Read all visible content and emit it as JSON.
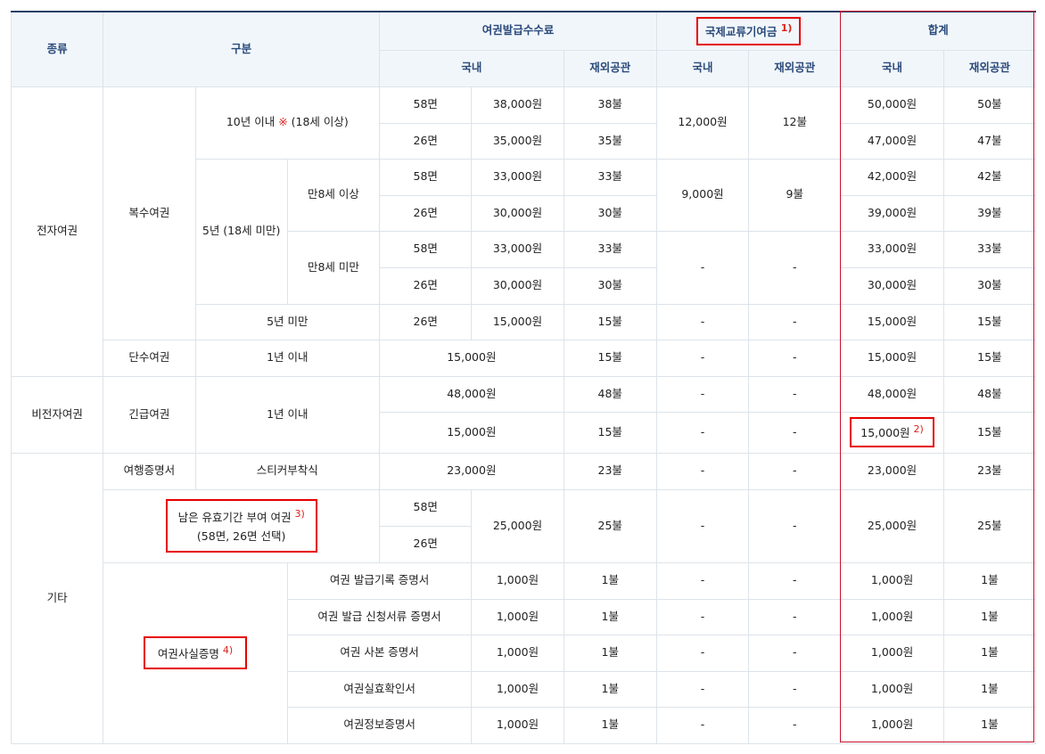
{
  "header": {
    "type": "종류",
    "category": "구분",
    "fee": "여권발급수수료",
    "contribution": "국제교류기여금",
    "contribution_note": "1)",
    "total": "합계",
    "domestic": "국내",
    "overseas": "재외공관"
  },
  "electronic": {
    "type": "전자여권",
    "multiple": "복수여권",
    "ten_year_prefix": "10년 이내 ",
    "ten_year_mark": "※",
    "ten_year_suffix": " (18세 이상)",
    "five_year": "5년 (18세 미만)",
    "age8_up": "만8세 이상",
    "age8_down": "만8세 미만",
    "under_five": "5년 미만",
    "single": "단수여권",
    "one_year": "1년 이내",
    "rows": [
      {
        "pages": "58면",
        "fee": "38,000원",
        "fee_ov": "38불",
        "total": "50,000원",
        "total_ov": "50불"
      },
      {
        "pages": "26면",
        "fee": "35,000원",
        "fee_ov": "35불",
        "total": "47,000원",
        "total_ov": "47불"
      },
      {
        "pages": "58면",
        "fee": "33,000원",
        "fee_ov": "33불",
        "total": "42,000원",
        "total_ov": "42불"
      },
      {
        "pages": "26면",
        "fee": "30,000원",
        "fee_ov": "30불",
        "total": "39,000원",
        "total_ov": "39불"
      },
      {
        "pages": "58면",
        "fee": "33,000원",
        "fee_ov": "33불",
        "total": "33,000원",
        "total_ov": "33불"
      },
      {
        "pages": "26면",
        "fee": "30,000원",
        "fee_ov": "30불",
        "total": "30,000원",
        "total_ov": "30불"
      },
      {
        "pages": "26면",
        "fee": "15,000원",
        "fee_ov": "15불",
        "total": "15,000원",
        "total_ov": "15불"
      }
    ],
    "contrib_10y": "12,000원",
    "contrib_10y_ov": "12불",
    "contrib_5y": "9,000원",
    "contrib_5y_ov": "9불",
    "single_fee": "15,000원",
    "single_fee_ov": "15불",
    "single_total": "15,000원",
    "single_total_ov": "15불"
  },
  "non_electronic": {
    "type": "비전자여권",
    "emergency": "긴급여권",
    "one_year": "1년 이내",
    "rows": [
      {
        "fee": "48,000원",
        "fee_ov": "48불",
        "total": "48,000원",
        "total_ov": "48불"
      },
      {
        "fee": "15,000원",
        "fee_ov": "15불",
        "total": "15,000원",
        "total_ov": "15불",
        "note": "2)"
      }
    ]
  },
  "other": {
    "type": "기타",
    "travel_cert": "여행증명서",
    "sticker": "스티커부착식",
    "travel_fee": "23,000원",
    "travel_fee_ov": "23불",
    "travel_total": "23,000원",
    "travel_total_ov": "23불",
    "remaining_line1": "남은 유효기간 부여 여권",
    "remaining_note": "3)",
    "remaining_line2": "(58면, 26면 선택)",
    "remaining_p58": "58면",
    "remaining_p26": "26면",
    "remaining_fee": "25,000원",
    "remaining_fee_ov": "25불",
    "remaining_total": "25,000원",
    "remaining_total_ov": "25불",
    "fact_cert": "여권사실증명",
    "fact_note": "4)",
    "certs": [
      {
        "name": "여권 발급기록 증명서",
        "fee": "1,000원",
        "fee_ov": "1불",
        "total": "1,000원",
        "total_ov": "1불"
      },
      {
        "name": "여권 발급 신청서류 증명서",
        "fee": "1,000원",
        "fee_ov": "1불",
        "total": "1,000원",
        "total_ov": "1불"
      },
      {
        "name": "여권 사본 증명서",
        "fee": "1,000원",
        "fee_ov": "1불",
        "total": "1,000원",
        "total_ov": "1불"
      },
      {
        "name": "여권실효확인서",
        "fee": "1,000원",
        "fee_ov": "1불",
        "total": "1,000원",
        "total_ov": "1불"
      },
      {
        "name": "여권정보증명서",
        "fee": "1,000원",
        "fee_ov": "1불",
        "total": "1,000원",
        "total_ov": "1불"
      }
    ]
  },
  "dash": "-"
}
